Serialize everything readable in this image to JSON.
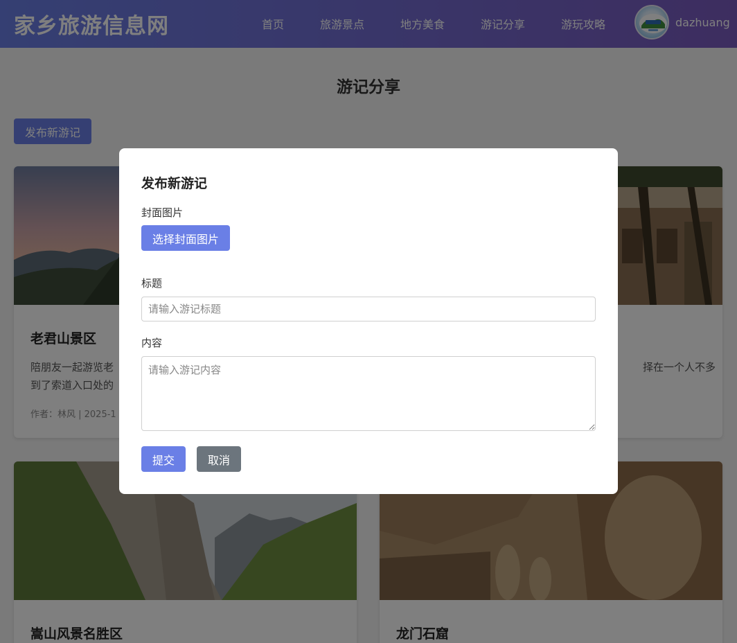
{
  "header": {
    "logo": "家乡旅游信息网",
    "nav": [
      "首页",
      "旅游景点",
      "地方美食",
      "游记分享",
      "游玩攻略"
    ],
    "username": "dazhuang"
  },
  "main": {
    "section_title": "游记分享",
    "publish_button": "发布新游记",
    "cards": [
      {
        "title": "老君山景区",
        "desc": "陪朋友一起游览老",
        "desc2": "到了索道入口处的",
        "meta": "作者：林风 | 2025-1"
      },
      {
        "desc": "择在一个人不多"
      },
      {
        "title": "嵩山风景名胜区"
      },
      {
        "title": "龙门石窟"
      }
    ]
  },
  "modal": {
    "title": "发布新游记",
    "cover_label": "封面图片",
    "cover_button": "选择封面图片",
    "title_label": "标题",
    "title_placeholder": "请输入游记标题",
    "content_label": "内容",
    "content_placeholder": "请输入游记内容",
    "submit": "提交",
    "cancel": "取消"
  },
  "colors": {
    "accent": "#6a7fe6",
    "cancel": "#6c757d"
  }
}
